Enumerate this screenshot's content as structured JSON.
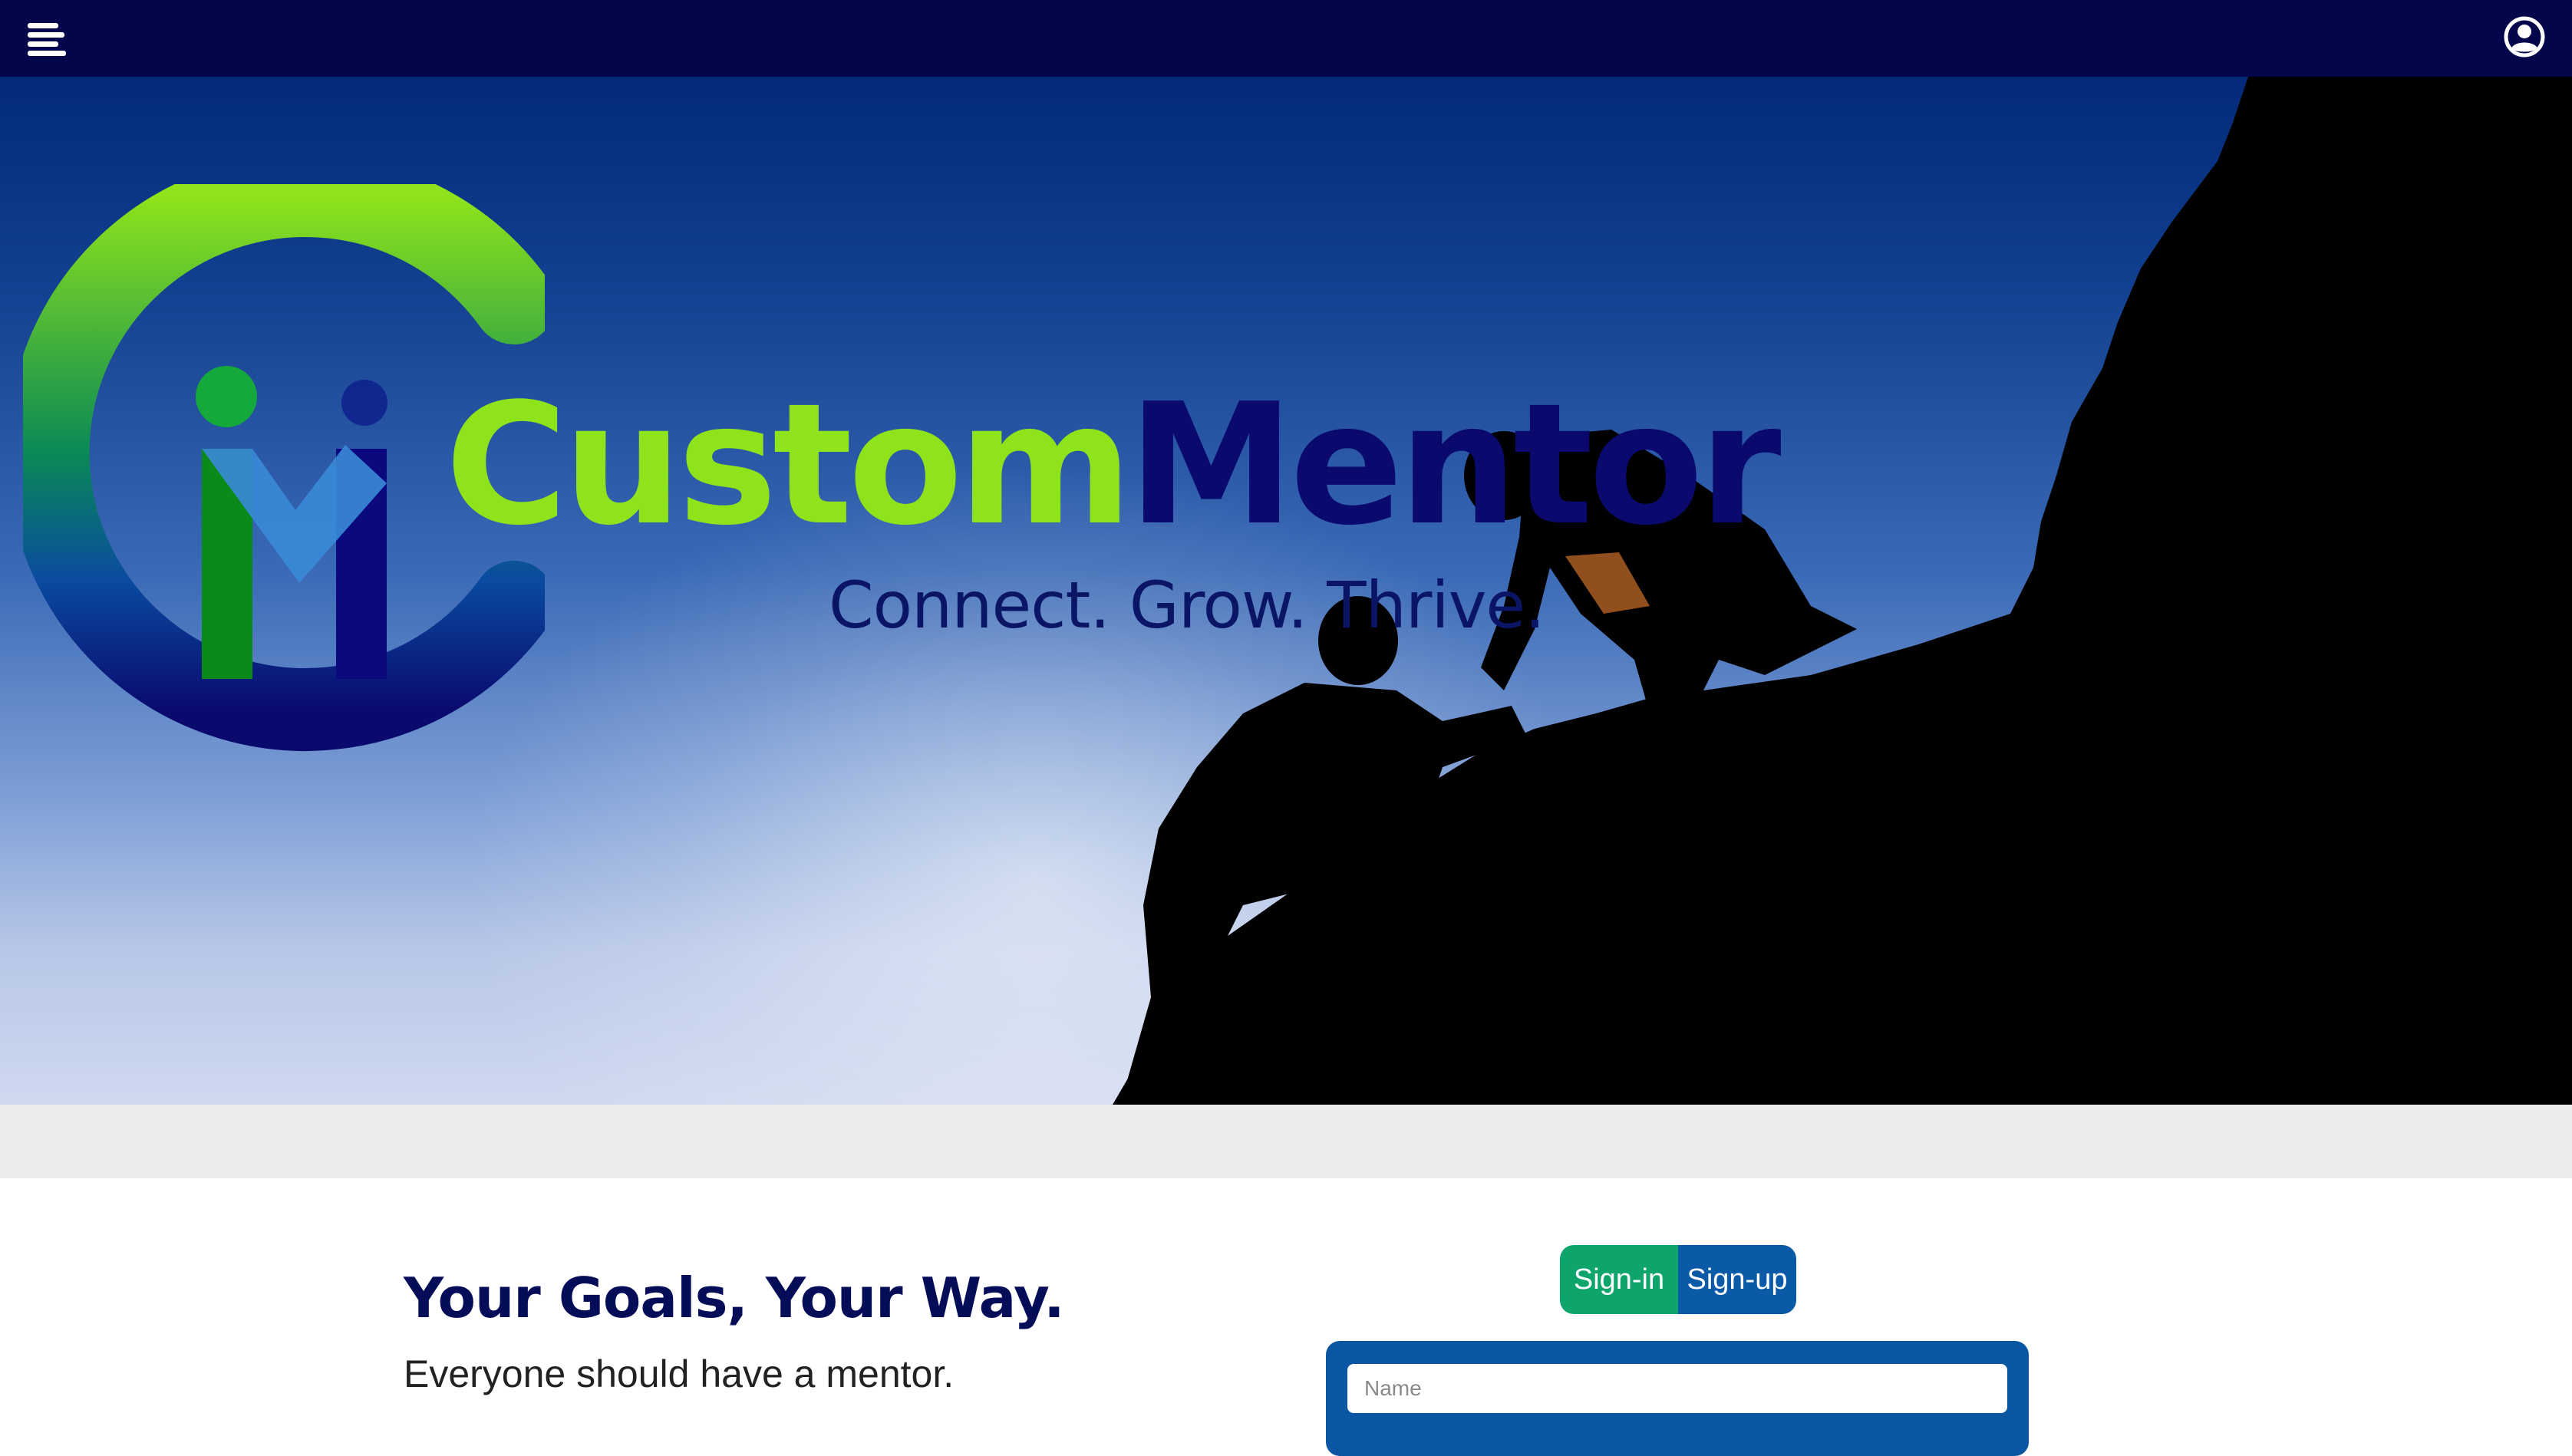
{
  "header": {
    "menu_icon": "menu-icon",
    "user_icon": "user-account-icon"
  },
  "brand": {
    "name_part1": "Custom",
    "name_part2": "Mentor",
    "tagline": "Connect. Grow. Thrive.",
    "colors": {
      "green": "#8fe31b",
      "navy": "#0a0a6e",
      "topbar": "#03064a"
    }
  },
  "intro": {
    "headline": "Your Goals, Your Way.",
    "subheadline": "Everyone should have a mentor."
  },
  "auth": {
    "signin_label": "Sign-in",
    "signup_label": "Sign-up",
    "name_placeholder": "Name",
    "colors": {
      "signin": "#0ea56b",
      "signup": "#0b5aa8"
    }
  }
}
